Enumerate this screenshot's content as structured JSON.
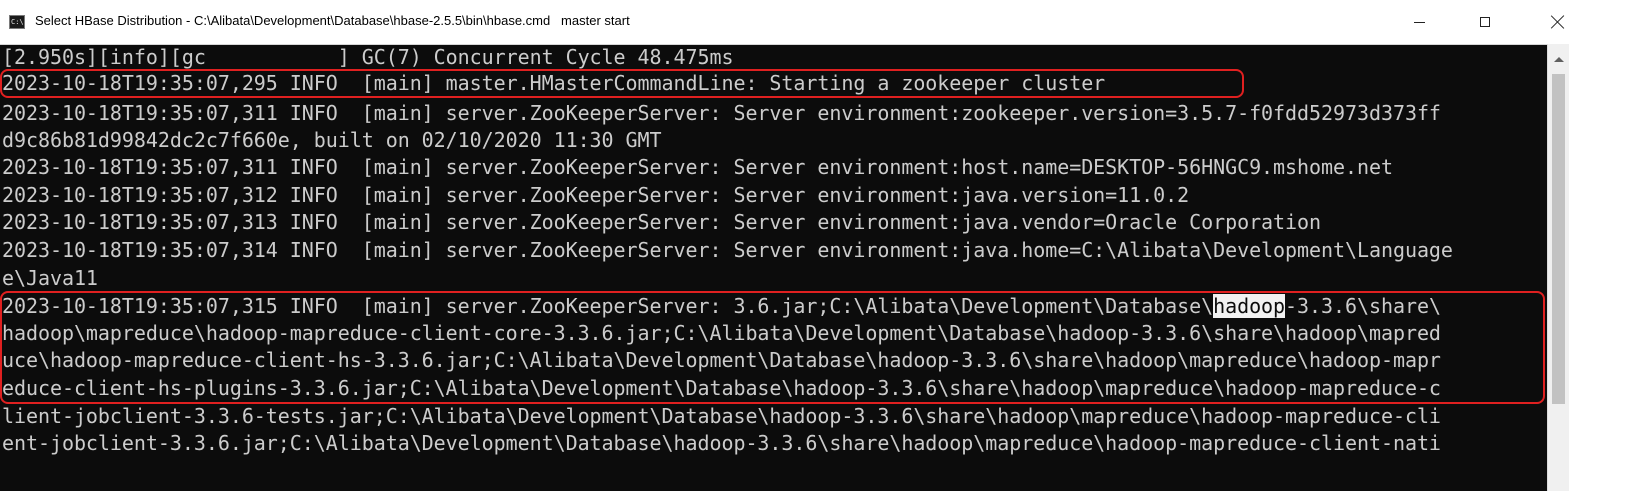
{
  "window": {
    "title": "Select HBase Distribution - C:\\Alibata\\Development\\Database\\hbase-2.5.5\\bin\\hbase.cmd   master start",
    "icon": "console-icon",
    "icon_glyph": "C:\\",
    "controls": {
      "minimize": "minimize-icon",
      "maximize": "maximize-icon",
      "close": "close-icon"
    }
  },
  "colors": {
    "console_bg": "#0c0c0c",
    "console_text": "#cccccc",
    "annotation": "#e02020",
    "selection_bg": "#f2f2f2"
  },
  "console": {
    "lines": [
      {
        "text": "[2.950s][info][gc           ] GC(7) Concurrent Cycle 48.475ms"
      },
      {
        "text": "2023-10-18T19:35:07,295 INFO  [main] master.HMasterCommandLine: Starting a zookeeper cluster"
      },
      {
        "text": "2023-10-18T19:35:07,311 INFO  [main] server.ZooKeeperServer: Server environment:zookeeper.version=3.5.7-f0fdd52973d373ff"
      },
      {
        "text": "d9c86b81d99842dc2c7f660e, built on 02/10/2020 11:30 GMT"
      },
      {
        "text": "2023-10-18T19:35:07,311 INFO  [main] server.ZooKeeperServer: Server environment:host.name=DESKTOP-56HNGC9.mshome.net"
      },
      {
        "text": "2023-10-18T19:35:07,312 INFO  [main] server.ZooKeeperServer: Server environment:java.version=11.0.2"
      },
      {
        "text": "2023-10-18T19:35:07,313 INFO  [main] server.ZooKeeperServer: Server environment:java.vendor=Oracle Corporation"
      },
      {
        "text": "2023-10-18T19:35:07,314 INFO  [main] server.ZooKeeperServer: Server environment:java.home=C:\\Alibata\\Development\\Language"
      },
      {
        "text": "e\\Java11"
      },
      {
        "pre": "2023-10-18T19:35:07,315 INFO  [main] server.ZooKeeperServer: 3.6.jar;C:\\Alibata\\Development\\Database\\",
        "selected": "hadoop",
        "post": "-3.3.6\\share\\"
      },
      {
        "text": "hadoop\\mapreduce\\hadoop-mapreduce-client-core-3.3.6.jar;C:\\Alibata\\Development\\Database\\hadoop-3.3.6\\share\\hadoop\\mapred"
      },
      {
        "text": "uce\\hadoop-mapreduce-client-hs-3.3.6.jar;C:\\Alibata\\Development\\Database\\hadoop-3.3.6\\share\\hadoop\\mapreduce\\hadoop-mapr"
      },
      {
        "text": "educe-client-hs-plugins-3.3.6.jar;C:\\Alibata\\Development\\Database\\hadoop-3.3.6\\share\\hadoop\\mapreduce\\hadoop-mapreduce-c"
      },
      {
        "text": "lient-jobclient-3.3.6-tests.jar;C:\\Alibata\\Development\\Database\\hadoop-3.3.6\\share\\hadoop\\mapreduce\\hadoop-mapreduce-cli"
      },
      {
        "text": "ent-jobclient-3.3.6.jar;C:\\Alibata\\Development\\Database\\hadoop-3.3.6\\share\\hadoop\\mapreduce\\hadoop-mapreduce-client-nati"
      }
    ]
  }
}
